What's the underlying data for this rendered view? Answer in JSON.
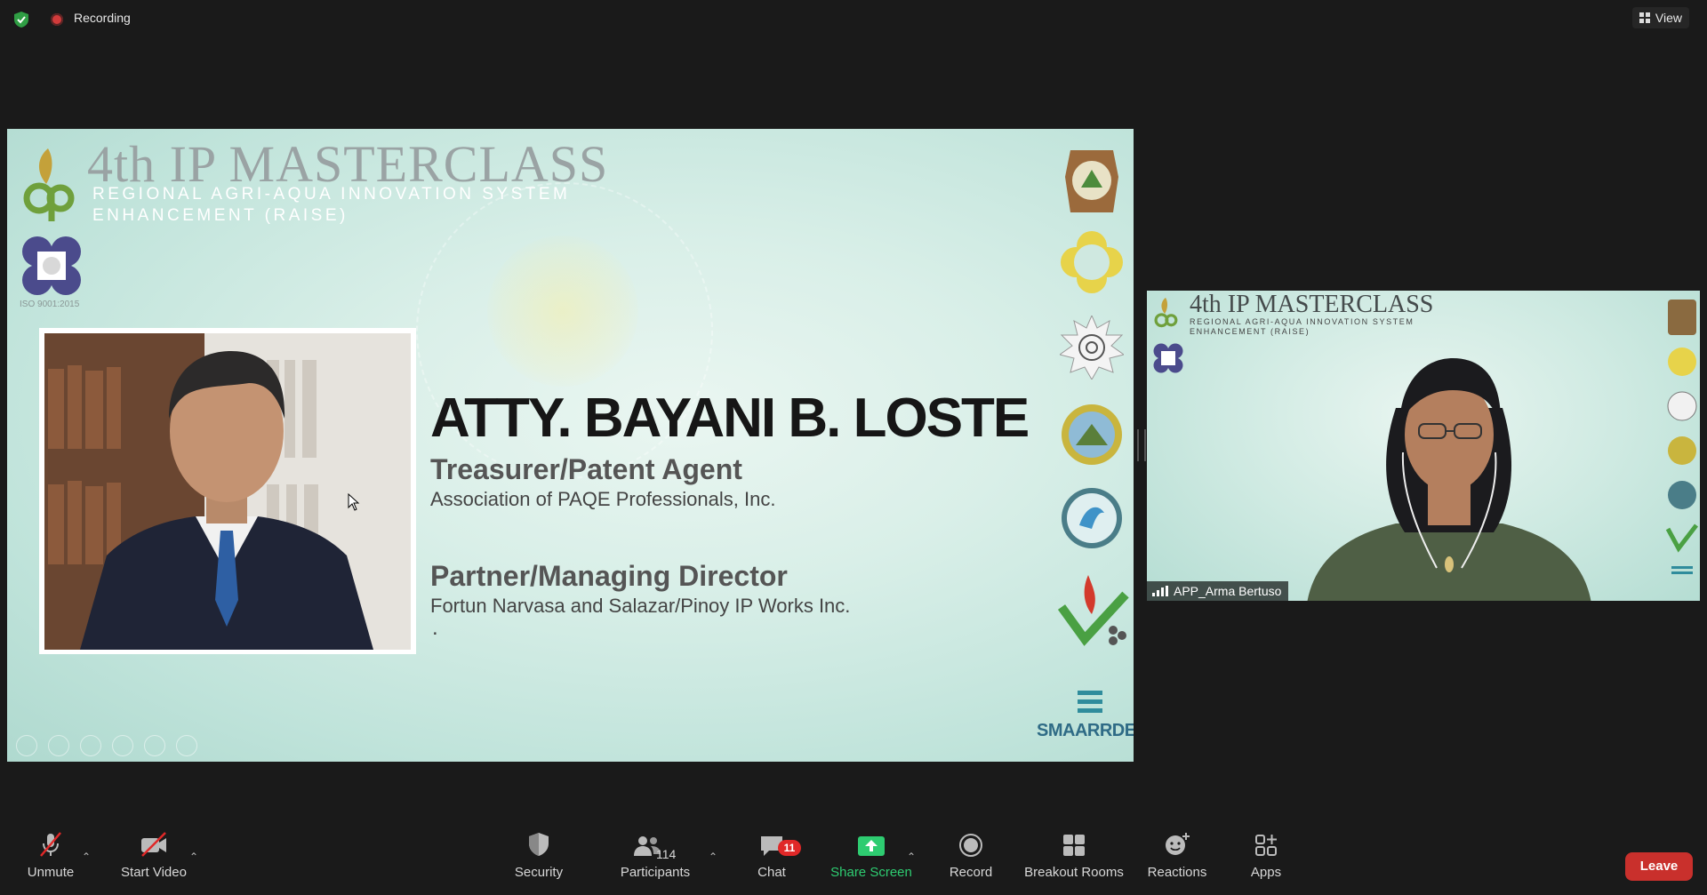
{
  "topbar": {
    "recording_label": "Recording",
    "view_label": "View"
  },
  "slide": {
    "title": "4th IP MASTERCLASS",
    "subtitle": "Regional Agri-Aqua Innovation System Enhancement (RAISE)",
    "iso_label": "ISO 9001:2015",
    "speaker_name": "ATTY. BAYANI B. LOSTE",
    "role_1": "Treasurer/Patent Agent",
    "org_1": "Association of PAQE Professionals, Inc.",
    "role_2": "Partner/Managing Director",
    "org_2": "Fortun Narvasa and Salazar/Pinoy IP Works Inc.",
    "trailing_dot": ".",
    "smaarrdec_label": "SMAARRDEC"
  },
  "video_tile": {
    "title": "4th IP MASTERCLASS",
    "subtitle": "Regional Agri-Aqua Innovation System Enhancement (RAISE)",
    "participant_name": "APP_Arma Bertuso"
  },
  "toolbar": {
    "unmute_label": "Unmute",
    "start_video_label": "Start Video",
    "security_label": "Security",
    "participants_label": "Participants",
    "participants_count": "114",
    "chat_label": "Chat",
    "chat_badge": "11",
    "share_screen_label": "Share Screen",
    "record_label": "Record",
    "breakout_rooms_label": "Breakout Rooms",
    "reactions_label": "Reactions",
    "apps_label": "Apps",
    "leave_label": "Leave"
  },
  "colors": {
    "app_background": "#1a1a1a",
    "share_green": "#2ecc71",
    "leave_red": "#c9302c",
    "badge_red": "#e02828",
    "recording_red": "#d23b3b",
    "shield_green": "#2f9e44"
  },
  "icons": {
    "encryption": "shield-check-icon",
    "recording": "record-dot-icon",
    "view": "grid-view-icon",
    "unmute": "muted-microphone-icon",
    "start_video": "video-off-icon",
    "security": "shield-icon",
    "participants": "people-icon",
    "chat": "chat-bubble-icon",
    "share_screen": "share-arrow-icon",
    "record": "record-circle-icon",
    "breakout_rooms": "grid-squares-icon",
    "reactions": "smiley-plus-icon",
    "apps": "apps-icon"
  }
}
